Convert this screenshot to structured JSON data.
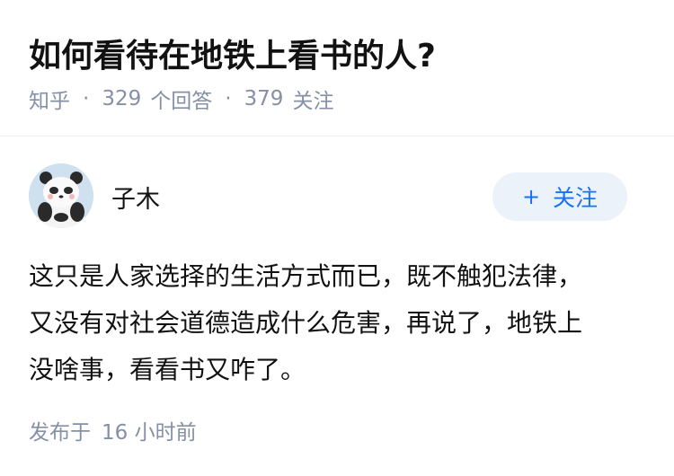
{
  "question": {
    "title": "如何看待在地铁上看书的人?",
    "source": "知乎",
    "separator": "·",
    "answers_count": "329",
    "answers_label": "个回答",
    "followers_count": "379",
    "followers_label": "关注"
  },
  "answer": {
    "author": {
      "name": "子木",
      "avatar_icon": "panda-avatar-icon"
    },
    "follow_button": {
      "icon": "+",
      "label": "关注"
    },
    "content_lines": [
      "这只是人家选择的生活方式而已，既不触犯法律，",
      "又没有对社会道德造成什么危害，再说了，地铁上",
      "没啥事，看看书又咋了。"
    ],
    "published": {
      "label": "发布于",
      "time": "16 小时前"
    }
  },
  "colors": {
    "meta_gray": "#8590a6",
    "brand_blue": "#1772f6",
    "follow_bg": "#ebf2fa",
    "text": "#121212"
  }
}
